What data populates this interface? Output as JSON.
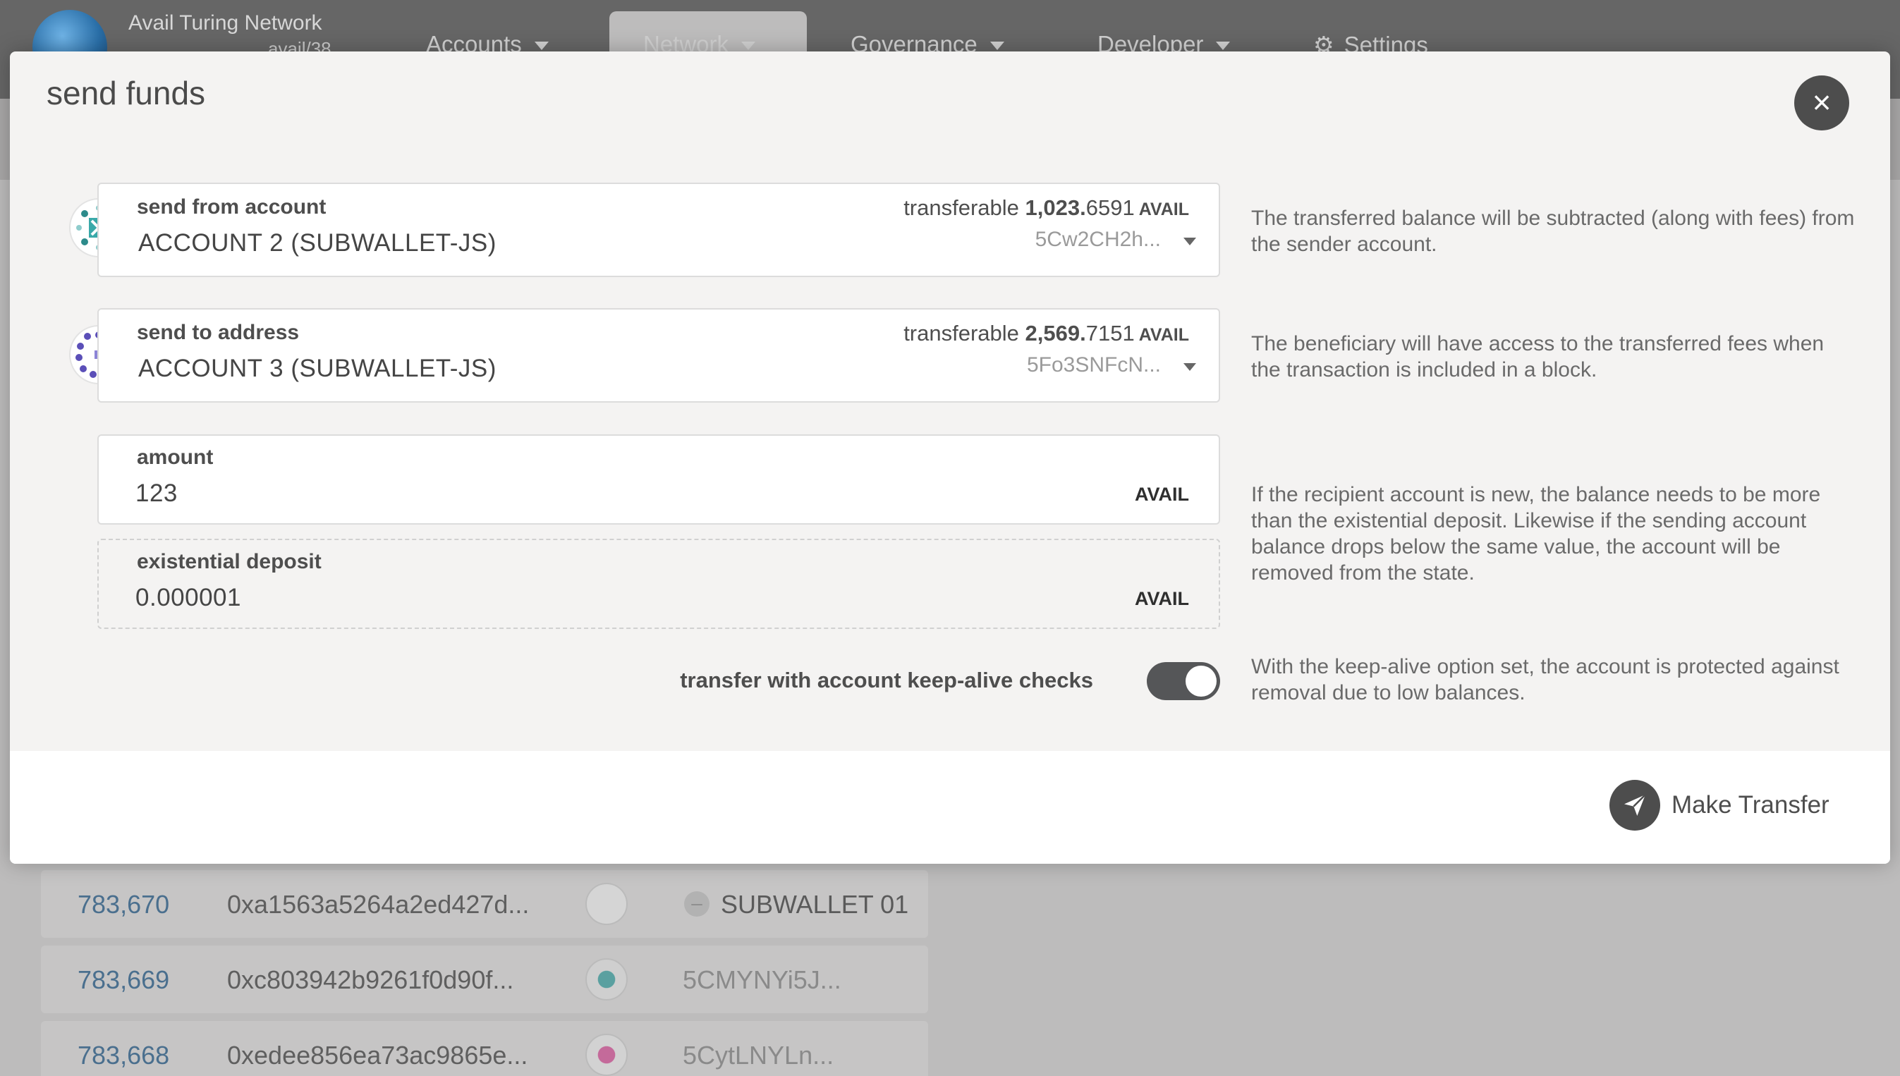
{
  "app": {
    "chain_name": "Avail Turing Network",
    "chain_version": "avail/38",
    "nav": [
      {
        "label": "Accounts"
      },
      {
        "label": "Network"
      },
      {
        "label": "Governance"
      },
      {
        "label": "Developer"
      },
      {
        "label": "Settings"
      }
    ]
  },
  "modal": {
    "title": "send funds",
    "close_icon": "close-icon",
    "from": {
      "label": "send from account",
      "account_name": "ACCOUNT 2 (SUBWALLET-JS)",
      "transferable_label": "transferable",
      "transferable_int": "1,023.",
      "transferable_dec": "6591",
      "unit": "AVAIL",
      "address": "5Cw2CH2h...",
      "help": "The transferred balance will be subtracted (along with fees) from the sender account."
    },
    "to": {
      "label": "send to address",
      "account_name": "ACCOUNT 3 (SUBWALLET-JS)",
      "transferable_label": "transferable",
      "transferable_int": "2,569.",
      "transferable_dec": "7151",
      "unit": "AVAIL",
      "address": "5Fo3SNFcN...",
      "help": "The beneficiary will have access to the transferred fees when the transaction is included in a block."
    },
    "amount": {
      "label": "amount",
      "value": "123",
      "unit": "AVAIL"
    },
    "existential_deposit": {
      "label": "existential deposit",
      "value": "0.000001",
      "unit": "AVAIL",
      "help": "If the recipient account is new, the balance needs to be more than the existential deposit. Likewise if the sending account balance drops below the same value, the account will be removed from the state."
    },
    "keep_alive": {
      "label": "transfer with account keep-alive checks",
      "enabled": true,
      "help": "With the keep-alive option set, the account is protected against removal due to low balances."
    },
    "submit_label": "Make Transfer"
  },
  "background_rows": [
    {
      "block": "783,670",
      "hash": "0xa1563a5264a2ed427d...",
      "who": "SUBWALLET 01"
    },
    {
      "block": "783,669",
      "hash": "0xc803942b9261f0d90f...",
      "who": "5CMYNYi5J..."
    },
    {
      "block": "783,668",
      "hash": "0xedee856ea73ac9865e...",
      "who": "5CytLNYLn..."
    }
  ]
}
